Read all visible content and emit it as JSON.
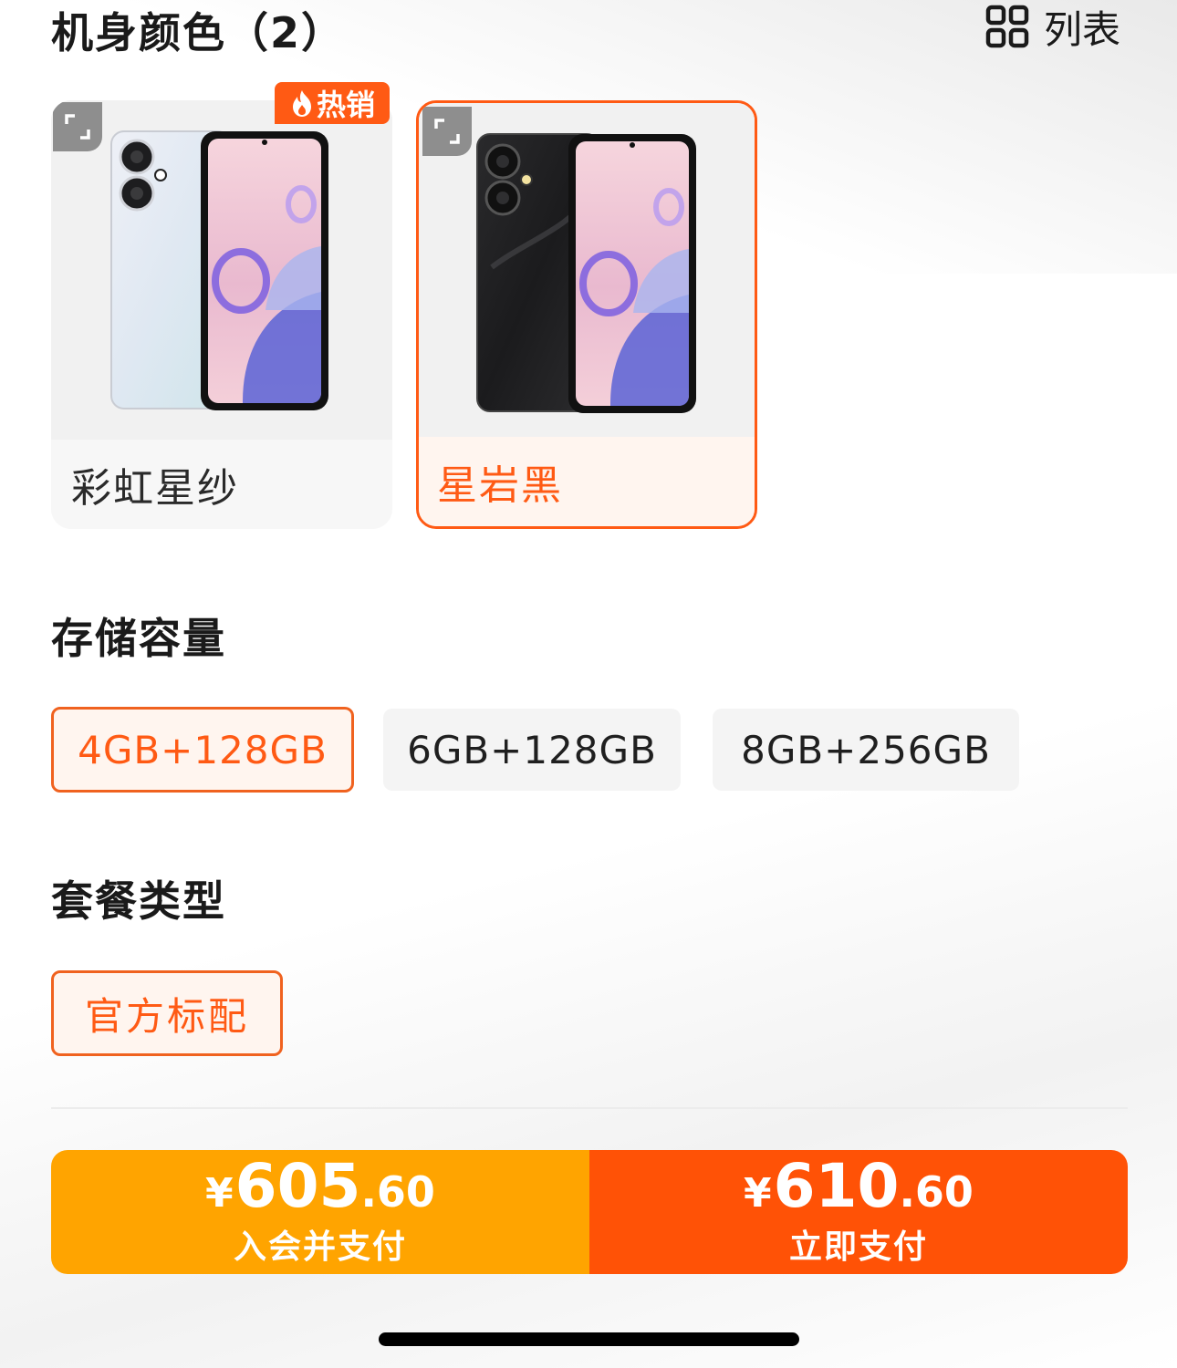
{
  "color_section": {
    "title": "机身颜色（2）",
    "list_toggle_label": "列表",
    "hot_badge": "热销",
    "options": [
      {
        "label": "彩虹星纱",
        "selected": false
      },
      {
        "label": "星岩黑",
        "selected": true
      }
    ]
  },
  "storage_section": {
    "title": "存储容量",
    "options": [
      {
        "label": "4GB+128GB",
        "selected": true
      },
      {
        "label": "6GB+128GB",
        "selected": false
      },
      {
        "label": "8GB+256GB",
        "selected": false
      }
    ]
  },
  "package_section": {
    "title": "套餐类型",
    "options": [
      {
        "label": "官方标配",
        "selected": true
      }
    ]
  },
  "pay_bar": {
    "member": {
      "currency": "¥",
      "integer": "605",
      "decimal": ".60",
      "label": "入会并支付",
      "color": "#ffa400"
    },
    "now": {
      "currency": "¥",
      "integer": "610",
      "decimal": ".60",
      "label": "立即支付",
      "color": "#ff5206"
    }
  },
  "colors": {
    "accent": "#ff5a14"
  }
}
